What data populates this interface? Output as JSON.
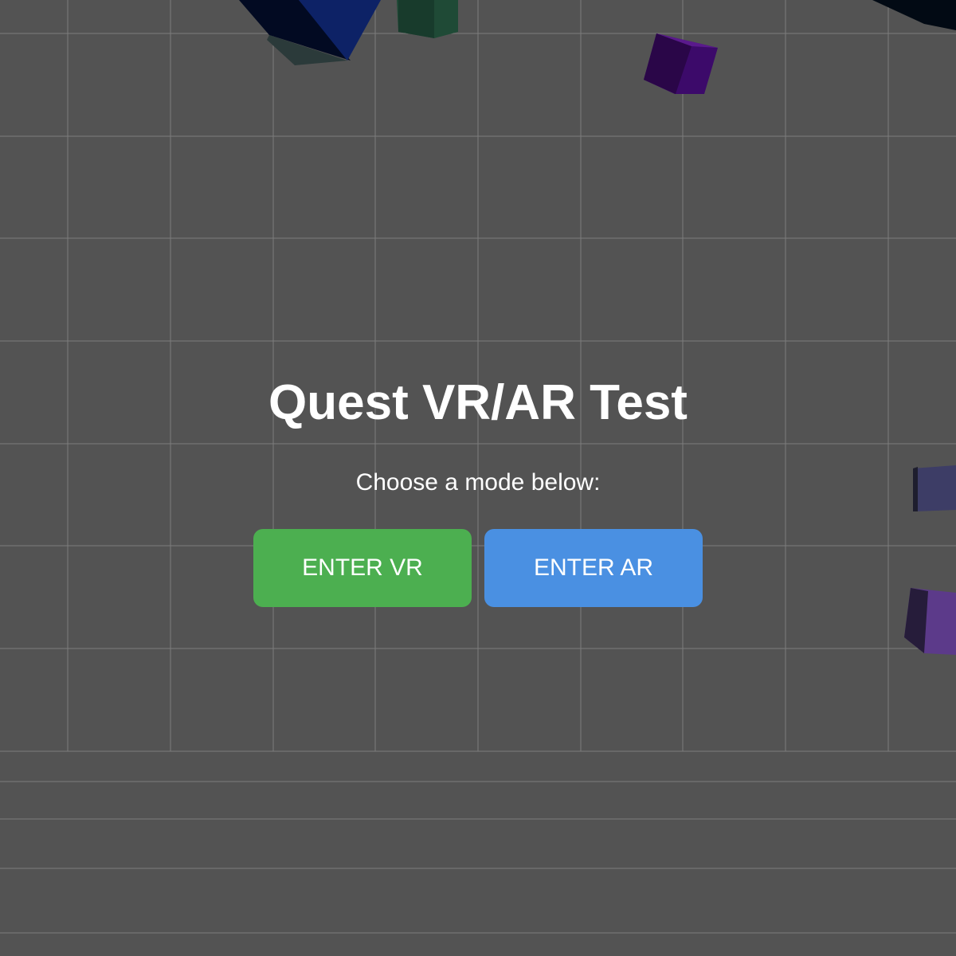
{
  "page": {
    "title": "Quest VR/AR Test",
    "subtitle": "Choose a mode below:"
  },
  "buttons": {
    "vr_label": "ENTER VR",
    "ar_label": "ENTER AR"
  },
  "colors": {
    "background": "#535353",
    "grid_line": "#8a8a8a",
    "vr_button": "#4caf50",
    "ar_button": "#4a90e2",
    "text": "#ffffff"
  }
}
